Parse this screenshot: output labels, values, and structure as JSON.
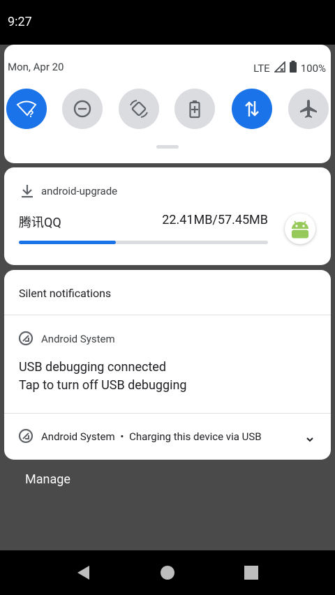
{
  "status_bar": {
    "time": "9:27"
  },
  "quick_settings": {
    "date": "Mon, Apr 20",
    "network": "LTE",
    "battery": "100%",
    "tiles": [
      {
        "name": "wifi-tile",
        "icon": "wifi-question-icon",
        "active": true
      },
      {
        "name": "dnd-tile",
        "icon": "do-not-disturb-icon",
        "active": false
      },
      {
        "name": "auto-rotate-tile",
        "icon": "auto-rotate-icon",
        "active": false
      },
      {
        "name": "battery-saver-tile",
        "icon": "battery-saver-icon",
        "active": false
      },
      {
        "name": "mobile-data-tile",
        "icon": "data-arrows-icon",
        "active": true
      },
      {
        "name": "airplane-tile",
        "icon": "airplane-icon",
        "active": false
      }
    ]
  },
  "download_notification": {
    "app": "android-upgrade",
    "title": "腾讯QQ",
    "size": "22.41MB/57.45MB",
    "progress": 0.39
  },
  "silent_section": {
    "header": "Silent notifications",
    "usb": {
      "app": "Android System",
      "title": "USB debugging connected",
      "text": "Tap to turn off USB debugging"
    },
    "charging": {
      "app": "Android System",
      "separator": "•",
      "text": "Charging this device via USB"
    }
  },
  "manage_label": "Manage",
  "colors": {
    "accent": "#1a73e8",
    "tile_off": "#dadce0",
    "scrim": "#4a4a4a"
  }
}
